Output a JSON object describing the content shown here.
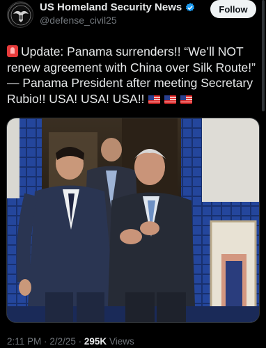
{
  "account": {
    "display_name": "US Homeland Security News",
    "handle": "@defense_civil25",
    "follow_label": "Follow",
    "avatar_icon": "eagle-seal-icon",
    "verified_icon": "verified-badge-icon",
    "verified_color": "#1d9bf0"
  },
  "tweet": {
    "text": "Update: Panama surrenders!! “We’ll NOT renew agreement with China over Silk Route!” — Panama President after meeting Secretary Rubio!! USA! USA! USA!!",
    "lead_emoji": "siren-emoji",
    "trailing_emoji": [
      "us-flag-emoji",
      "us-flag-emoji",
      "us-flag-emoji"
    ]
  },
  "meta": {
    "time": "2:11 PM",
    "separator": "·",
    "date": "2/2/25",
    "views_count": "295K",
    "views_label": "Views"
  },
  "colors": {
    "background": "#000000",
    "text": "#e7e9ea",
    "secondary": "#71767b",
    "tile_blue": "#1f3c8a"
  }
}
